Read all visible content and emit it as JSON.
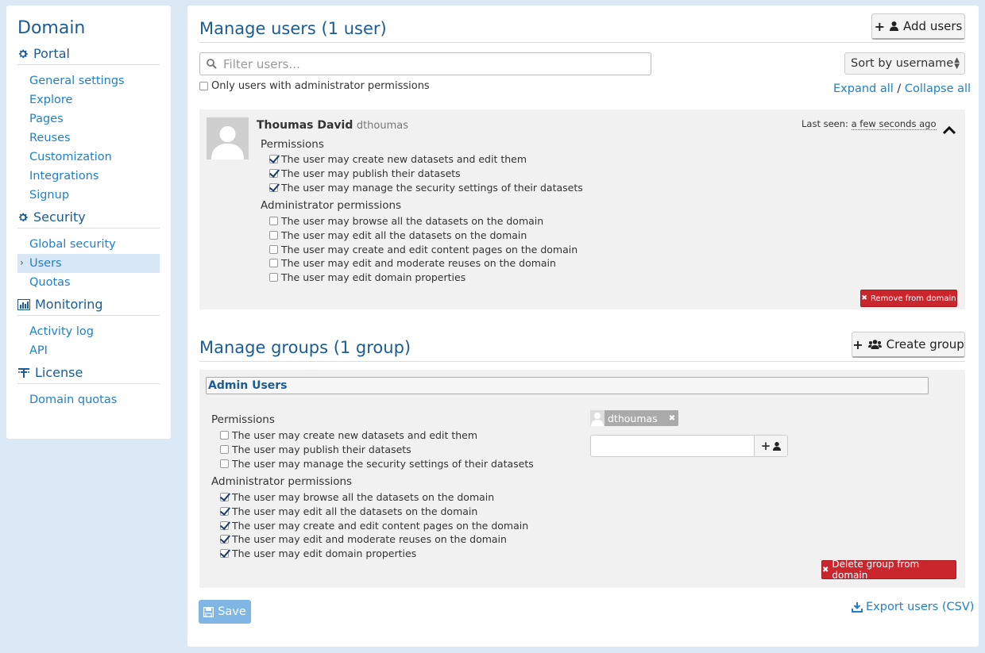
{
  "sidebar": {
    "domain_title": "Domain",
    "sections": [
      {
        "title": "Portal",
        "icon": "gear-icon",
        "items": [
          "General settings",
          "Explore",
          "Pages",
          "Reuses",
          "Customization",
          "Integrations",
          "Signup"
        ]
      },
      {
        "title": "Security",
        "icon": "gear-icon",
        "items": [
          "Global security",
          "Users",
          "Quotas"
        ],
        "active": "Users"
      },
      {
        "title": "Monitoring",
        "icon": "bar-chart-icon",
        "items": [
          "Activity log",
          "API"
        ]
      },
      {
        "title": "License",
        "icon": "license-icon",
        "items": [
          "Domain quotas"
        ]
      }
    ]
  },
  "users": {
    "title": "Manage users (1 user)",
    "add_label": "Add users",
    "filter_placeholder": "Filter users...",
    "sort_label": "Sort by username",
    "admin_only_label": "Only users with administrator permissions",
    "expand_all": "Expand all",
    "separator": "/",
    "collapse_all": "Collapse all",
    "user": {
      "name": "Thoumas David",
      "username": "dthoumas",
      "last_seen_label": "Last seen:",
      "last_seen_value": "a few seconds ago",
      "permissions_title": "Permissions",
      "permissions": [
        {
          "label": "The user may create new datasets and edit them",
          "checked": true
        },
        {
          "label": "The user may publish their datasets",
          "checked": true
        },
        {
          "label": "The user may manage the security settings of their datasets",
          "checked": true
        }
      ],
      "admin_title": "Administrator permissions",
      "admin_permissions": [
        {
          "label": "The user may browse all the datasets on the domain",
          "checked": false
        },
        {
          "label": "The user may edit all the datasets on the domain",
          "checked": false
        },
        {
          "label": "The user may create and edit content pages on the domain",
          "checked": false
        },
        {
          "label": "The user may edit and moderate reuses on the domain",
          "checked": false
        },
        {
          "label": "The user may edit domain properties",
          "checked": false
        }
      ],
      "remove_label": "Remove from domain"
    }
  },
  "groups": {
    "title": "Manage groups (1 group)",
    "create_label": "Create group",
    "group": {
      "name": "Admin Users",
      "member_tag": "dthoumas",
      "permissions_title": "Permissions",
      "permissions": [
        {
          "label": "The user may create new datasets and edit them",
          "checked": false
        },
        {
          "label": "The user may publish their datasets",
          "checked": false
        },
        {
          "label": "The user may manage the security settings of their datasets",
          "checked": false
        }
      ],
      "admin_title": "Administrator permissions",
      "admin_permissions": [
        {
          "label": "The user may browse all the datasets on the domain",
          "checked": true
        },
        {
          "label": "The user may edit all the datasets on the domain",
          "checked": true
        },
        {
          "label": "The user may create and edit content pages on the domain",
          "checked": true
        },
        {
          "label": "The user may edit and moderate reuses on the domain",
          "checked": true
        },
        {
          "label": "The user may edit domain properties",
          "checked": true
        }
      ],
      "delete_label": "Delete group from domain"
    }
  },
  "footer": {
    "save_label": "Save",
    "export_label": "Export users (CSV)"
  },
  "colors": {
    "accent": "#1b5c93",
    "link": "#1f80c7",
    "danger": "#c9262d",
    "save": "#7fb6e6",
    "page_bg": "#dbe9f7"
  }
}
